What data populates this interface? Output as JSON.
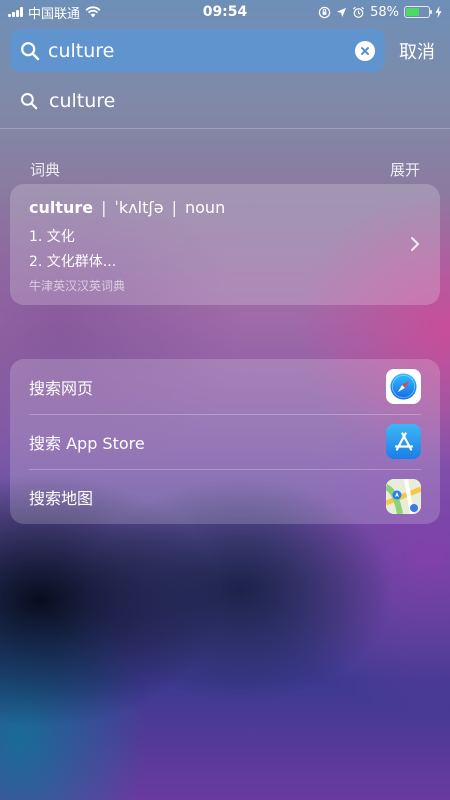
{
  "status_bar": {
    "carrier": "中国联通",
    "time": "09:54",
    "battery_percent": "58%",
    "battery_level": 0.58,
    "icons": [
      "signal-icon",
      "wifi-icon",
      "lock-rotation-icon",
      "location-icon",
      "alarm-icon",
      "battery-icon",
      "charging-icon"
    ]
  },
  "search": {
    "query": "culture",
    "cancel_label": "取消",
    "icons": [
      "search-icon",
      "clear-icon"
    ]
  },
  "suggestion": {
    "text": "culture",
    "icon": "search-icon"
  },
  "dictionary": {
    "section_title": "词典",
    "expand_label": "展开",
    "word": "culture",
    "separator": "|",
    "pronunciation": "ˈkʌltʃə",
    "part_of_speech": "noun",
    "definitions": [
      "1. 文化",
      "2. 文化群体..."
    ],
    "source": "牛津英汉汉英词典",
    "icon": "chevron-right-icon"
  },
  "web_actions": [
    {
      "label": "搜索网页",
      "icon": "safari-icon"
    },
    {
      "label": "搜索 App Store",
      "icon": "app-store-icon"
    },
    {
      "label": "搜索地图",
      "icon": "maps-icon"
    }
  ],
  "colors": {
    "search_field": "#5a96d7",
    "battery_fill": "#4cd964",
    "app_store_blue": "#1a7fe6"
  }
}
